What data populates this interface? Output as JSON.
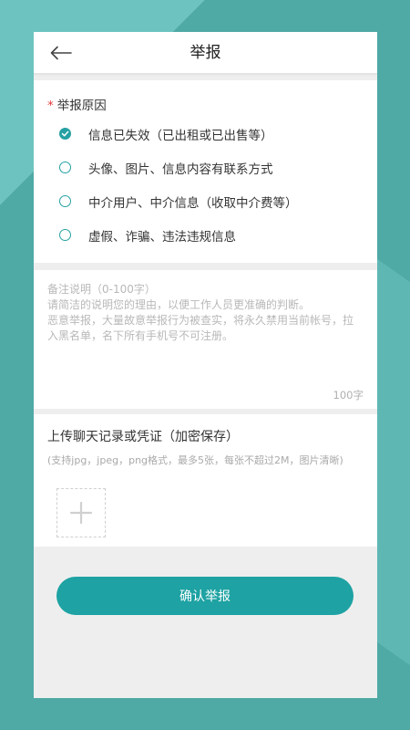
{
  "header": {
    "title": "举报",
    "back_icon": "arrow-left-icon"
  },
  "reason": {
    "title": "举报原因",
    "required_mark": "*",
    "options": [
      {
        "label": "信息已失效（已出租或已出售等）",
        "checked": true
      },
      {
        "label": "头像、图片、信息内容有联系方式",
        "checked": false
      },
      {
        "label": "中介用户、中介信息（收取中介费等）",
        "checked": false
      },
      {
        "label": "虚假、诈骗、违法违规信息",
        "checked": false
      }
    ]
  },
  "note": {
    "placeholder": "备注说明（0-100字）\n请简洁的说明您的理由，以便工作人员更准确的判断。\n恶意举报，大量故意举报行为被查实，将永久禁用当前帐号，拉入黑名单，名下所有手机号不可注册。",
    "value": "",
    "counter": "100字"
  },
  "upload": {
    "title": "上传聊天记录或凭证（加密保存）",
    "hint": "(支持jpg，jpeg，png格式，最多5张，每张不超过2M，图片清晰)",
    "add_icon": "plus-icon"
  },
  "submit": {
    "label": "确认举报"
  },
  "colors": {
    "accent": "#1ea2a3",
    "background": "#4fa7a4",
    "required": "#e03c3c"
  }
}
